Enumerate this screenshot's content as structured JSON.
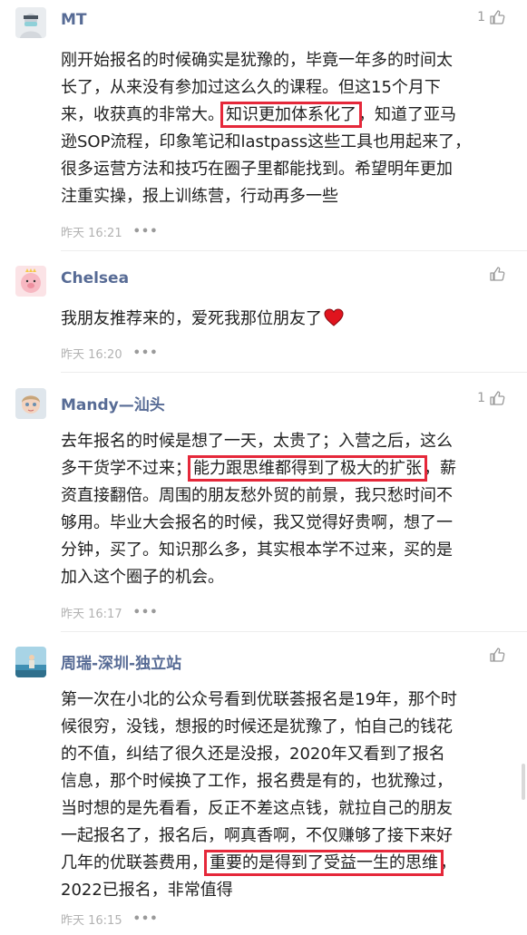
{
  "comments": [
    {
      "name": "MT",
      "likes": "1",
      "lines": [
        [
          {
            "t": "刚开始报名的时候确实是犹豫的，毕竟一年多的时间太"
          }
        ],
        [
          {
            "t": "长了，从来没有参加过这么久的课程。但这15个月下"
          }
        ],
        [
          {
            "t": "来，收获真的非常大。"
          },
          {
            "t": "知识更加体系化了",
            "hl": true
          },
          {
            "t": "，知道了亚马"
          }
        ],
        [
          {
            "t": "逊SOP流程，印象笔记和lastpass这些工具也用起来了，"
          }
        ],
        [
          {
            "t": "很多运营方法和技巧在圈子里都能找到。希望明年更加"
          }
        ],
        [
          {
            "t": "注重实操，报上训练营，行动再多一些"
          }
        ]
      ],
      "time": "昨天 16:21"
    },
    {
      "name": "Chelsea",
      "likes": "",
      "lines": [
        [
          {
            "t": "我朋友推荐来的，爱死我那位朋友了"
          }
        ]
      ],
      "emoji": "heart-emoji",
      "time": "昨天 16:20"
    },
    {
      "name": "Mandy—汕头",
      "likes": "1",
      "lines": [
        [
          {
            "t": "去年报名的时候是想了一天，太贵了；入营之后，这么"
          }
        ],
        [
          {
            "t": "多干货学不过来；"
          },
          {
            "t": "能力跟思维都得到了极大的扩张",
            "hl": true
          },
          {
            "t": "，薪"
          }
        ],
        [
          {
            "t": "资直接翻倍。周围的朋友愁外贸的前景，我只愁时间不"
          }
        ],
        [
          {
            "t": "够用。毕业大会报名的时候，我又觉得好贵啊，想了一"
          }
        ],
        [
          {
            "t": "分钟，买了。知识那么多，其实根本学不过来，买的是"
          }
        ],
        [
          {
            "t": "加入这个圈子的机会。"
          }
        ]
      ],
      "time": "昨天 16:17"
    },
    {
      "name": "周瑞-深圳-独立站",
      "likes": "",
      "lines": [
        [
          {
            "t": "第一次在小北的公众号看到优联荟报名是19年，那个时"
          }
        ],
        [
          {
            "t": "候很穷，没钱，想报的时候还是犹豫了，怕自己的钱花"
          }
        ],
        [
          {
            "t": "的不值，纠结了很久还是没报，2020年又看到了报名"
          }
        ],
        [
          {
            "t": "信息，那个时候换了工作，报名费是有的，也犹豫过，"
          }
        ],
        [
          {
            "t": "当时想的是先看看，反正不差这点钱，就拉自己的朋友"
          }
        ],
        [
          {
            "t": "一起报名了，报名后，啊真香啊，不仅赚够了接下来好"
          }
        ],
        [
          {
            "t": "几年的优联荟费用，"
          },
          {
            "t": "重要的是得到了受益一生的思维",
            "hl": true
          },
          {
            "t": "，"
          }
        ],
        [
          {
            "t": "2022已报名，非常值得"
          }
        ]
      ],
      "time": "昨天 16:15"
    }
  ],
  "colors": {
    "name": "#576b95",
    "highlight_box": "#e5283a",
    "meta": "#b2b2b2"
  }
}
